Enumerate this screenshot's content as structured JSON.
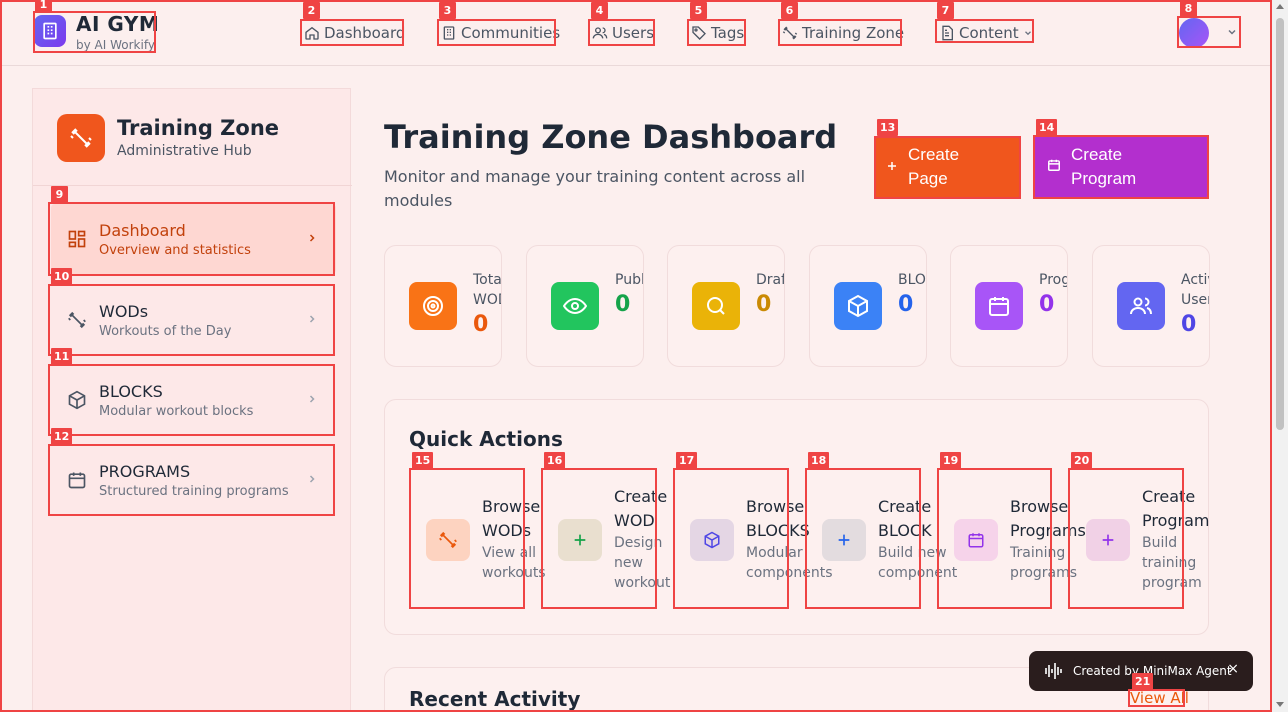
{
  "header": {
    "brand_name": "AI GYM",
    "brand_sub": "by AI Workify",
    "nav": [
      {
        "label": "Dashboard",
        "icon": "home-icon"
      },
      {
        "label": "Communities",
        "icon": "building-icon"
      },
      {
        "label": "Users",
        "icon": "users-icon"
      },
      {
        "label": "Tags",
        "icon": "tag-icon"
      },
      {
        "label": "Training Zone",
        "icon": "dumbbell-icon"
      },
      {
        "label": "Content",
        "icon": "document-icon"
      }
    ]
  },
  "sidebar": {
    "title": "Training Zone",
    "subtitle": "Administrative Hub",
    "items": [
      {
        "label": "Dashboard",
        "sub": "Overview and statistics",
        "icon": "dashboard-icon",
        "active": true
      },
      {
        "label": "WODs",
        "sub": "Workouts of the Day",
        "icon": "dumbbell-icon",
        "active": false
      },
      {
        "label": "BLOCKS",
        "sub": "Modular workout blocks",
        "icon": "cube-icon",
        "active": false
      },
      {
        "label": "PROGRAMS",
        "sub": "Structured training programs",
        "icon": "calendar-icon",
        "active": false
      }
    ]
  },
  "main": {
    "title": "Training Zone Dashboard",
    "subtitle": "Monitor and manage your training content across all modules",
    "create_page": "Create Page",
    "create_program": "Create Program",
    "stats": [
      {
        "label": "Total WODs",
        "value": "0",
        "icon": "target-icon",
        "color": "#f97316",
        "value_color": "#ea580c"
      },
      {
        "label": "Published",
        "value": "0",
        "icon": "eye-icon",
        "color": "#22c55e",
        "value_color": "#16a34a"
      },
      {
        "label": "Drafts",
        "value": "0",
        "icon": "search-icon",
        "color": "#eab308",
        "value_color": "#ca8a04"
      },
      {
        "label": "BLOCKS",
        "value": "0",
        "icon": "cube-icon",
        "color": "#3b82f6",
        "value_color": "#2563eb"
      },
      {
        "label": "Programs",
        "value": "0",
        "icon": "calendar-icon",
        "color": "#a855f7",
        "value_color": "#9333ea"
      },
      {
        "label": "Active Users",
        "value": "0",
        "icon": "users-icon",
        "color": "#6366f1",
        "value_color": "#4f46e5"
      }
    ],
    "quick_actions_title": "Quick Actions",
    "quick_actions": [
      {
        "label": "Browse WODs",
        "sub": "View all workouts",
        "icon": "dumbbell-icon"
      },
      {
        "label": "Create WOD",
        "sub": "Design new workout",
        "icon": "plus-icon"
      },
      {
        "label": "Browse BLOCKS",
        "sub": "Modular components",
        "icon": "cube-icon"
      },
      {
        "label": "Create BLOCK",
        "sub": "Build new component",
        "icon": "plus-icon"
      },
      {
        "label": "Browse Programs",
        "sub": "Training programs",
        "icon": "calendar-icon"
      },
      {
        "label": "Create Program",
        "sub": "Build training program",
        "icon": "plus-icon"
      }
    ],
    "recent_activity_title": "Recent Activity",
    "view_all": "View All"
  },
  "toast": {
    "text": "Created by MiniMax Agent",
    "close": "×"
  },
  "annotations": [
    "1",
    "2",
    "3",
    "4",
    "5",
    "6",
    "7",
    "8",
    "9",
    "10",
    "11",
    "12",
    "13",
    "14",
    "15",
    "16",
    "17",
    "18",
    "19",
    "20",
    "21"
  ]
}
